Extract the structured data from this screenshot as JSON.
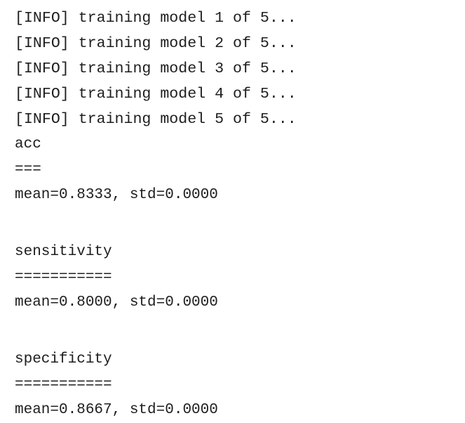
{
  "console": {
    "info_lines": [
      "[INFO] training model 1 of 5...",
      "[INFO] training model 2 of 5...",
      "[INFO] training model 3 of 5...",
      "[INFO] training model 4 of 5...",
      "[INFO] training model 5 of 5..."
    ],
    "metrics": [
      {
        "name": "acc",
        "underline": "===",
        "summary": "mean=0.8333, std=0.0000"
      },
      {
        "name": "sensitivity",
        "underline": "===========",
        "summary": "mean=0.8000, std=0.0000"
      },
      {
        "name": "specificity",
        "underline": "===========",
        "summary": "mean=0.8667, std=0.0000"
      }
    ]
  }
}
